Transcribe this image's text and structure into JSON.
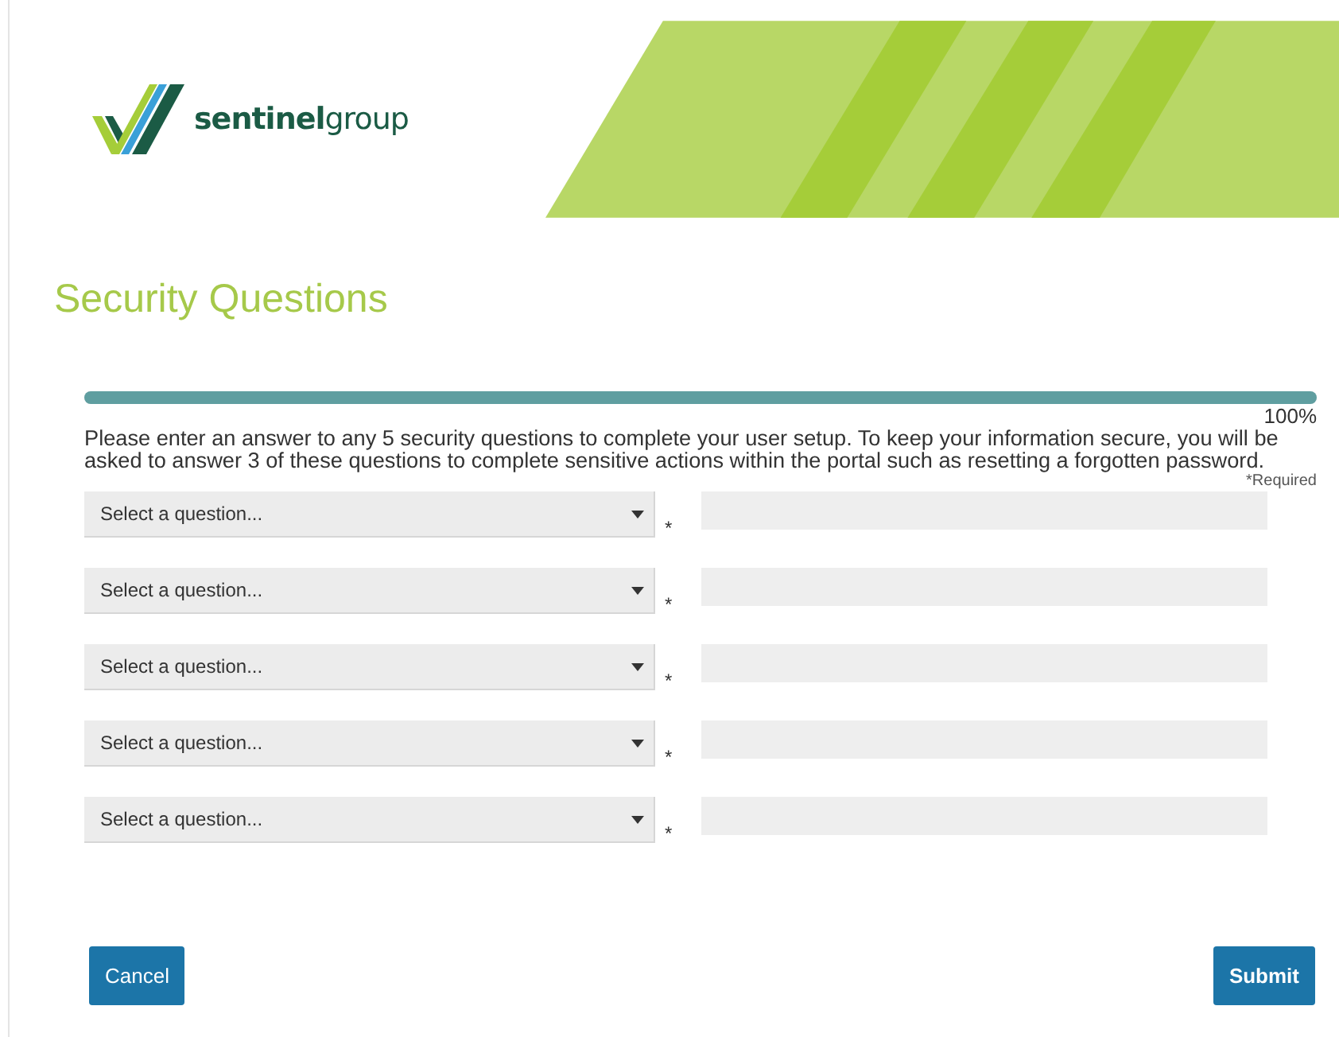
{
  "logo": {
    "text": "**sentinel**group"
  },
  "title": "Security Questions",
  "progress": {
    "level": 1,
    "label": "100%"
  },
  "instructions": "Please enter an answer to any 5 security questions to complete your user setup. To keep your information secure, you will be asked to answer 3 of these questions to complete sensitive actions within the portal such as resetting a forgotten password.",
  "required_note": "*Required",
  "questions": [
    {
      "select": "Select a question...",
      "required_mark": "*"
    },
    {
      "select": "Select a question...",
      "required_mark": "*"
    },
    {
      "select": "Select a question...",
      "required_mark": "*"
    },
    {
      "select": "Select a question...",
      "required_mark": "*"
    },
    {
      "select": "Select a question...",
      "required_mark": "*"
    }
  ],
  "buttons": [
    {
      "label": "Cancel",
      "kind": "cancel"
    },
    {
      "label": "Submit",
      "kind": "submit"
    }
  ]
}
